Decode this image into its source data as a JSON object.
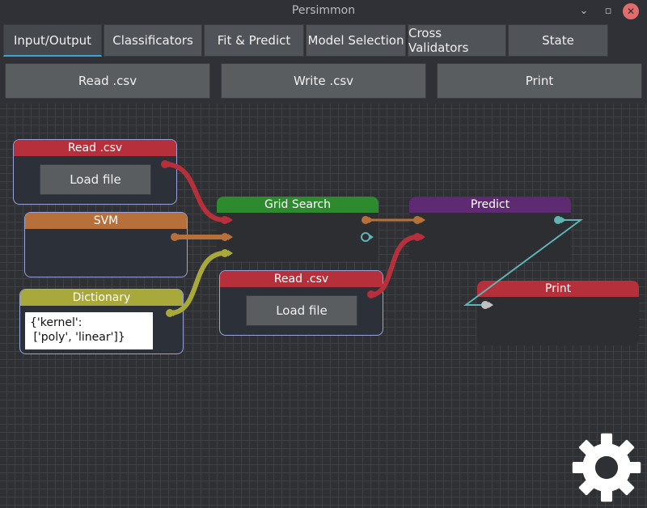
{
  "window": {
    "title": "Persimmon",
    "minimize_glyph": "⌄",
    "restore_glyph": "▫",
    "close_glyph": "✕"
  },
  "tabs": [
    {
      "label": "Input/Output",
      "active": true
    },
    {
      "label": "Classificators"
    },
    {
      "label": "Fit & Predict"
    },
    {
      "label": "Model Selection"
    },
    {
      "label": "Cross Validators"
    },
    {
      "label": "State"
    }
  ],
  "toolbar": {
    "read_label": "Read .csv",
    "write_label": "Write .csv",
    "print_label": "Print"
  },
  "nodes": {
    "read_csv_1": {
      "title": "Read .csv",
      "button": "Load file"
    },
    "svm": {
      "title": "SVM"
    },
    "dictionary": {
      "title": "Dictionary",
      "value": "{'kernel':\n ['poly', 'linear']}"
    },
    "grid_search": {
      "title": "Grid Search"
    },
    "read_csv_2": {
      "title": "Read .csv",
      "button": "Load file"
    },
    "predict": {
      "title": "Predict"
    },
    "print": {
      "title": "Print"
    }
  },
  "colors": {
    "red": "#b5303a",
    "orange": "#b8703a",
    "olive": "#a9a83a",
    "green": "#2e8a2e",
    "purple": "#5e2a72",
    "teal": "#5fb3b3"
  },
  "icons": {
    "settings": "gear-icon"
  }
}
